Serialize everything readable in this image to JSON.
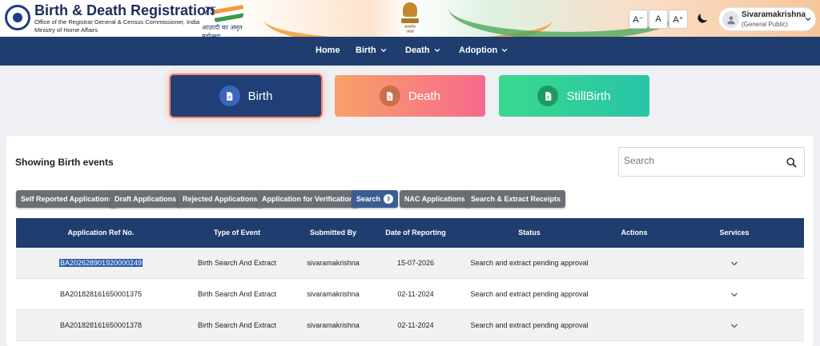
{
  "header": {
    "title": "Birth & Death Registration",
    "subtitle1": "Office of the Registrar General & Census Commissioner, India",
    "subtitle2": "Ministry of Home Affairs",
    "azadi_num": "75",
    "azadi_text": "आज़ादी का अमृत महोत्सव",
    "font_small": "A⁻",
    "font_normal": "A",
    "font_large": "A⁺",
    "user_name": "Sivaramakrishna",
    "user_role": "(General Public)"
  },
  "nav": {
    "items": [
      {
        "label": "Home",
        "dropdown": false
      },
      {
        "label": "Birth",
        "dropdown": true
      },
      {
        "label": "Death",
        "dropdown": true
      },
      {
        "label": "Adoption",
        "dropdown": true
      }
    ]
  },
  "events": {
    "birth": "Birth",
    "death": "Death",
    "stillbirth": "StillBirth"
  },
  "main": {
    "showing": "Showing Birth events",
    "search_placeholder": "Search",
    "tabs": [
      {
        "label": "Self Reported Applications"
      },
      {
        "label": "Draft Applications"
      },
      {
        "label": "Rejected Applications"
      },
      {
        "label": "Application for Verification"
      },
      {
        "label": "Search",
        "badge": "3",
        "active": true
      },
      {
        "label": "NAC Applications"
      },
      {
        "label": "Search & Extract Receipts"
      }
    ]
  },
  "table": {
    "headers": [
      "Application Ref No.",
      "Type of Event",
      "Submitted By",
      "Date of Reporting",
      "Status",
      "Actions",
      "Services"
    ],
    "rows": [
      {
        "ref": "BA202628901920000249",
        "type": "Birth Search And Extract",
        "by": "sivaramakrishna",
        "date": "15-07-2026",
        "status": "Search and extract pending approval",
        "actions": ""
      },
      {
        "ref": "BA201828161650001375",
        "type": "Birth Search And Extract",
        "by": "sivaramakrishna",
        "date": "02-11-2024",
        "status": "Search and extract pending approval",
        "actions": ""
      },
      {
        "ref": "BA201828161650001378",
        "type": "Birth Search And Extract",
        "by": "sivaramakrishna",
        "date": "02-11-2024",
        "status": "Search and extract pending approval",
        "actions": ""
      }
    ]
  },
  "colors": {
    "navy": "#1f3d6e",
    "birth_glow": "#f2866a",
    "death_start": "#f9a068",
    "death_end": "#f66a8d",
    "still_start": "#3ad98e",
    "still_end": "#29c3a8"
  }
}
